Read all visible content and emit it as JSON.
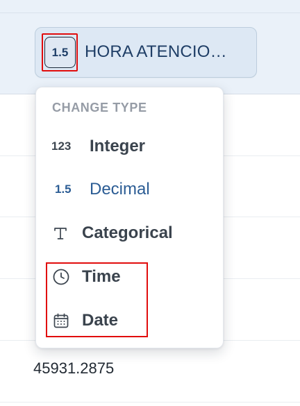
{
  "column_header": {
    "type_badge": "1.5",
    "name": "HORA ATENCIO…"
  },
  "table": {
    "visible_cell": "45931.2875"
  },
  "menu": {
    "header": "CHANGE TYPE",
    "items": [
      {
        "icon_text": "123",
        "icon": "integer-icon",
        "label": "Integer",
        "active": false
      },
      {
        "icon_text": "1.5",
        "icon": "decimal-icon",
        "label": "Decimal",
        "active": true
      },
      {
        "icon_text": "",
        "icon": "text-t-icon",
        "label": "Categorical",
        "active": false
      },
      {
        "icon_text": "",
        "icon": "clock-icon",
        "label": "Time",
        "active": false
      },
      {
        "icon_text": "",
        "icon": "calendar-icon",
        "label": "Date",
        "active": false
      }
    ]
  },
  "colors": {
    "accent": "#2b5c94",
    "highlight": "#e10c0c",
    "header_bg": "#eaf1f9"
  }
}
